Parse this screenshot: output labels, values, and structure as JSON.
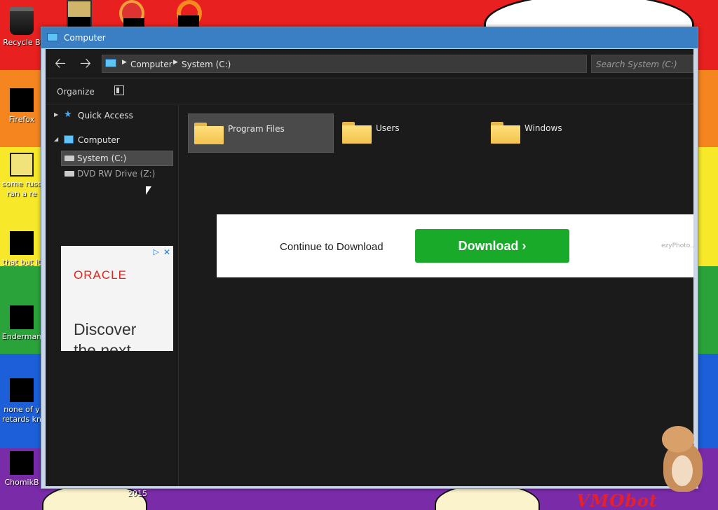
{
  "desktop": {
    "icons": [
      {
        "label": "Recycle B"
      },
      {
        "label": "Firefox"
      },
      {
        "label": "some russ\nran a re"
      },
      {
        "label": "that but it"
      },
      {
        "label": "Enderman"
      },
      {
        "label": "none of y\nretards kn"
      },
      {
        "label": "ChomikB"
      }
    ],
    "bottom_label": "2015",
    "corner_text": "VMObot"
  },
  "window": {
    "title": "Computer",
    "address": {
      "crumbs": [
        "Computer",
        "System (C:)"
      ]
    },
    "search_placeholder": "Search System (C:)",
    "toolbar": {
      "organize": "Organize"
    },
    "sidebar": {
      "quick_access": "Quick Access",
      "computer": "Computer",
      "drives": [
        "System (C:)",
        "DVD RW Drive (Z:)"
      ]
    },
    "folders": [
      "Program Files",
      "Users",
      "Windows"
    ]
  },
  "ads": {
    "sidebar_ad": {
      "brand": "ORACLE",
      "headline": "Discover\nthe next"
    },
    "banner": {
      "prompt": "Continue to Download",
      "button": "Download ›",
      "brand": "ezyPhoto..."
    }
  }
}
